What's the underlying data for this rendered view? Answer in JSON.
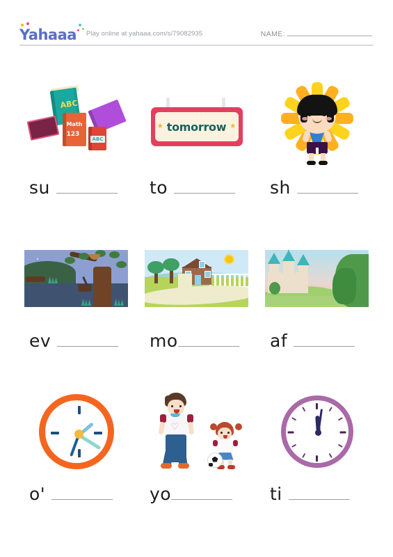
{
  "header": {
    "logo_text": "Yahaaa",
    "play_online": "Play online at yahaaa.com/s/79082935",
    "name_label": "NAME:"
  },
  "worksheet": {
    "items": [
      {
        "prompt": "su",
        "blank": "",
        "spacing": "gap",
        "image": "stack-of-school-books",
        "book_labels": {
          "abc": "ABC",
          "math": "Math",
          "numbers": "123",
          "abc_small": "ABC"
        }
      },
      {
        "prompt": "to",
        "blank": "",
        "spacing": "gap",
        "image": "tomorrow-sign",
        "sign_text": "tomorrow",
        "sign_star": "★"
      },
      {
        "prompt": "sh",
        "blank": "",
        "spacing": "gap",
        "image": "child-in-sunflower-costume"
      },
      {
        "prompt": "ev",
        "blank": "",
        "spacing": "gap",
        "image": "evening-tree-with-moon-scene"
      },
      {
        "prompt": "mo",
        "blank": "",
        "spacing": "tight",
        "image": "morning-house-with-sun-scene"
      },
      {
        "prompt": "af",
        "blank": "",
        "spacing": "gap",
        "image": "afternoon-castle-scene"
      },
      {
        "prompt": "o'",
        "blank": "",
        "spacing": "gap",
        "image": "orange-wall-clock"
      },
      {
        "prompt": "yo",
        "blank": "",
        "spacing": "tight",
        "image": "boy-and-girl-playing-soccer"
      },
      {
        "prompt": "ti",
        "blank": "",
        "spacing": "gap",
        "image": "purple-wall-clock"
      }
    ]
  },
  "colors": {
    "logo_blue": "#5b6fc4",
    "sign_red": "#e33f5f",
    "sign_cream": "#fdf1e0",
    "sign_text_green": "#17635c",
    "clock_orange": "#f4661f",
    "clock_purple": "#a96aa8",
    "rule_gray": "#9a9da2",
    "muted_text": "#9a9da3"
  }
}
